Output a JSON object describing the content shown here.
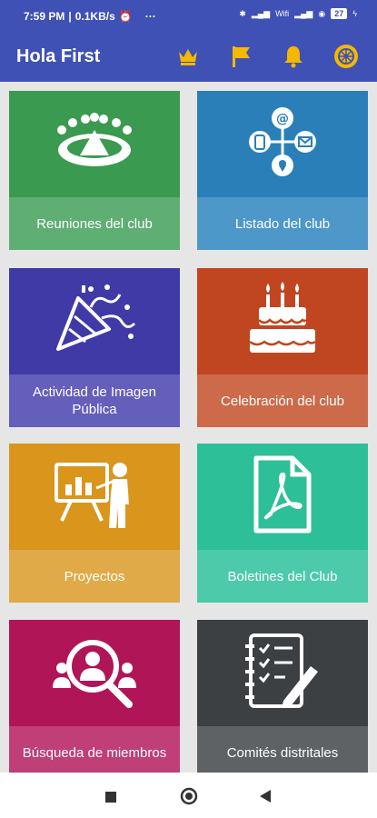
{
  "status_bar": {
    "time": "7:59 PM",
    "speed": "0.1KB/s",
    "dots": "···",
    "wifi_label": "Wifi",
    "battery": "27"
  },
  "app_bar": {
    "title": "Hola First",
    "icons": [
      "crown-icon",
      "flag-icon",
      "bell-icon",
      "rotary-wheel-icon"
    ],
    "icon_color": "#f5b800"
  },
  "tiles": [
    {
      "label": "Reuniones del club",
      "color": "#3a9a4f",
      "bar": "#5fae73"
    },
    {
      "label": "Listado del club",
      "color": "#2a7fb8",
      "bar": "#4d98c8"
    },
    {
      "label": "Actividad de Imagen Pública",
      "color": "#3f3aa6",
      "bar": "#635fbb"
    },
    {
      "label": "Celebración del club",
      "color": "#bf4620",
      "bar": "#cc6a4a"
    },
    {
      "label": "Proyectos",
      "color": "#d9951c",
      "bar": "#e0aa49"
    },
    {
      "label": "Boletines del Club",
      "color": "#2dbf97",
      "bar": "#4ccaa9"
    },
    {
      "label": "Búsqueda de miembros",
      "color": "#b01558",
      "bar": "#bf3f76"
    },
    {
      "label": "Comités distritales",
      "color": "#3d4043",
      "bar": "#5f6265"
    }
  ]
}
